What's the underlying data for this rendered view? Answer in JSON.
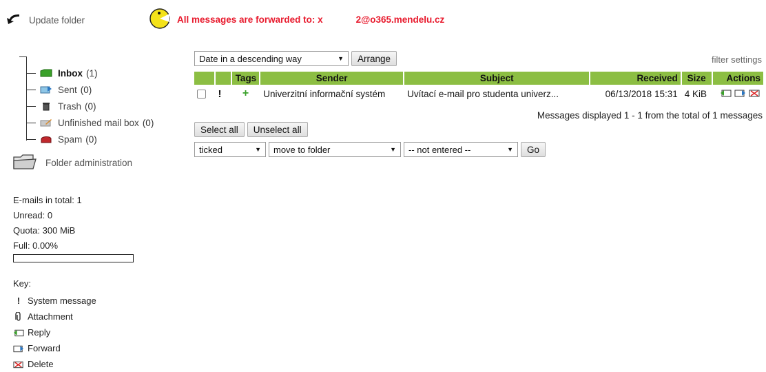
{
  "top": {
    "update_label": "Update folder",
    "forward_notice": "All messages are forwarded to: x",
    "forward_address": "2@o365.mendelu.cz"
  },
  "folders": [
    {
      "label": "Inbox",
      "count": "(1)",
      "icon": "inbox-icon",
      "active": true
    },
    {
      "label": "Sent",
      "count": "(0)",
      "icon": "sent-icon",
      "active": false
    },
    {
      "label": "Trash",
      "count": "(0)",
      "icon": "trash-icon",
      "active": false
    },
    {
      "label": "Unfinished mail box",
      "count": "(0)",
      "icon": "drafts-icon",
      "active": false
    },
    {
      "label": "Spam",
      "count": "(0)",
      "icon": "spam-icon",
      "active": false
    }
  ],
  "folder_admin": "Folder administration",
  "stats": {
    "total": "E-mails in total: 1",
    "unread": "Unread: 0",
    "quota": "Quota: 300 MiB",
    "full": "Full: 0.00%",
    "full_fraction": 0.0
  },
  "key": {
    "title": "Key:",
    "items": [
      "System message",
      "Attachment",
      "Reply",
      "Forward",
      "Delete"
    ]
  },
  "sort": {
    "selected": "Date in a descending way",
    "arrange_label": "Arrange",
    "filter_settings": "filter settings"
  },
  "table": {
    "headers": [
      "Tags",
      "Sender",
      "Subject",
      "Received",
      "Size",
      "Actions"
    ],
    "rows": [
      {
        "sender": "Univerzitní informační systém",
        "subject": "Uvítací e-mail pro studenta univerz...",
        "received": "06/13/2018 15:31",
        "size": "4 KiB"
      }
    ]
  },
  "displayed_text": "Messages displayed 1 - 1 from the total of 1 messages",
  "actions": {
    "select_all": "Select all",
    "unselect_all": "Unselect all",
    "scope": "ticked",
    "operation": "move to folder",
    "target": "-- not entered --",
    "go": "Go"
  },
  "colors": {
    "header_green": "#8cbe43",
    "notice_red": "#e8192c"
  }
}
